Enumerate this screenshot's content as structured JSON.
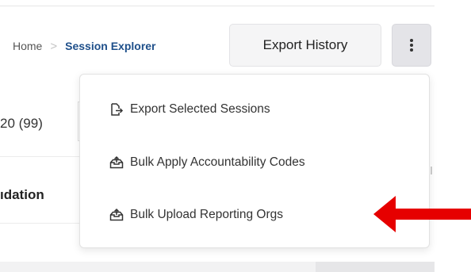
{
  "breadcrumb": {
    "home": "Home",
    "separator": ">",
    "current": "Session Explorer"
  },
  "toolbar": {
    "export_history_label": "Export History",
    "more_icon": "kebab-vertical-icon"
  },
  "background": {
    "count_fragment": "20 (99)",
    "column_fragment": "ıdation"
  },
  "menu": {
    "items": [
      {
        "label": "Export Selected Sessions",
        "icon": "export-icon"
      },
      {
        "label": "Bulk Apply Accountability Codes",
        "icon": "upload-tray-icon"
      },
      {
        "label": "Bulk Upload Reporting Orgs",
        "icon": "upload-tray-icon"
      }
    ]
  },
  "annotation": {
    "arrow_color": "#e60000",
    "points_to": "menu.items.2"
  },
  "colors": {
    "breadcrumb_current": "#1e4f8a",
    "menu_text": "#333333"
  }
}
